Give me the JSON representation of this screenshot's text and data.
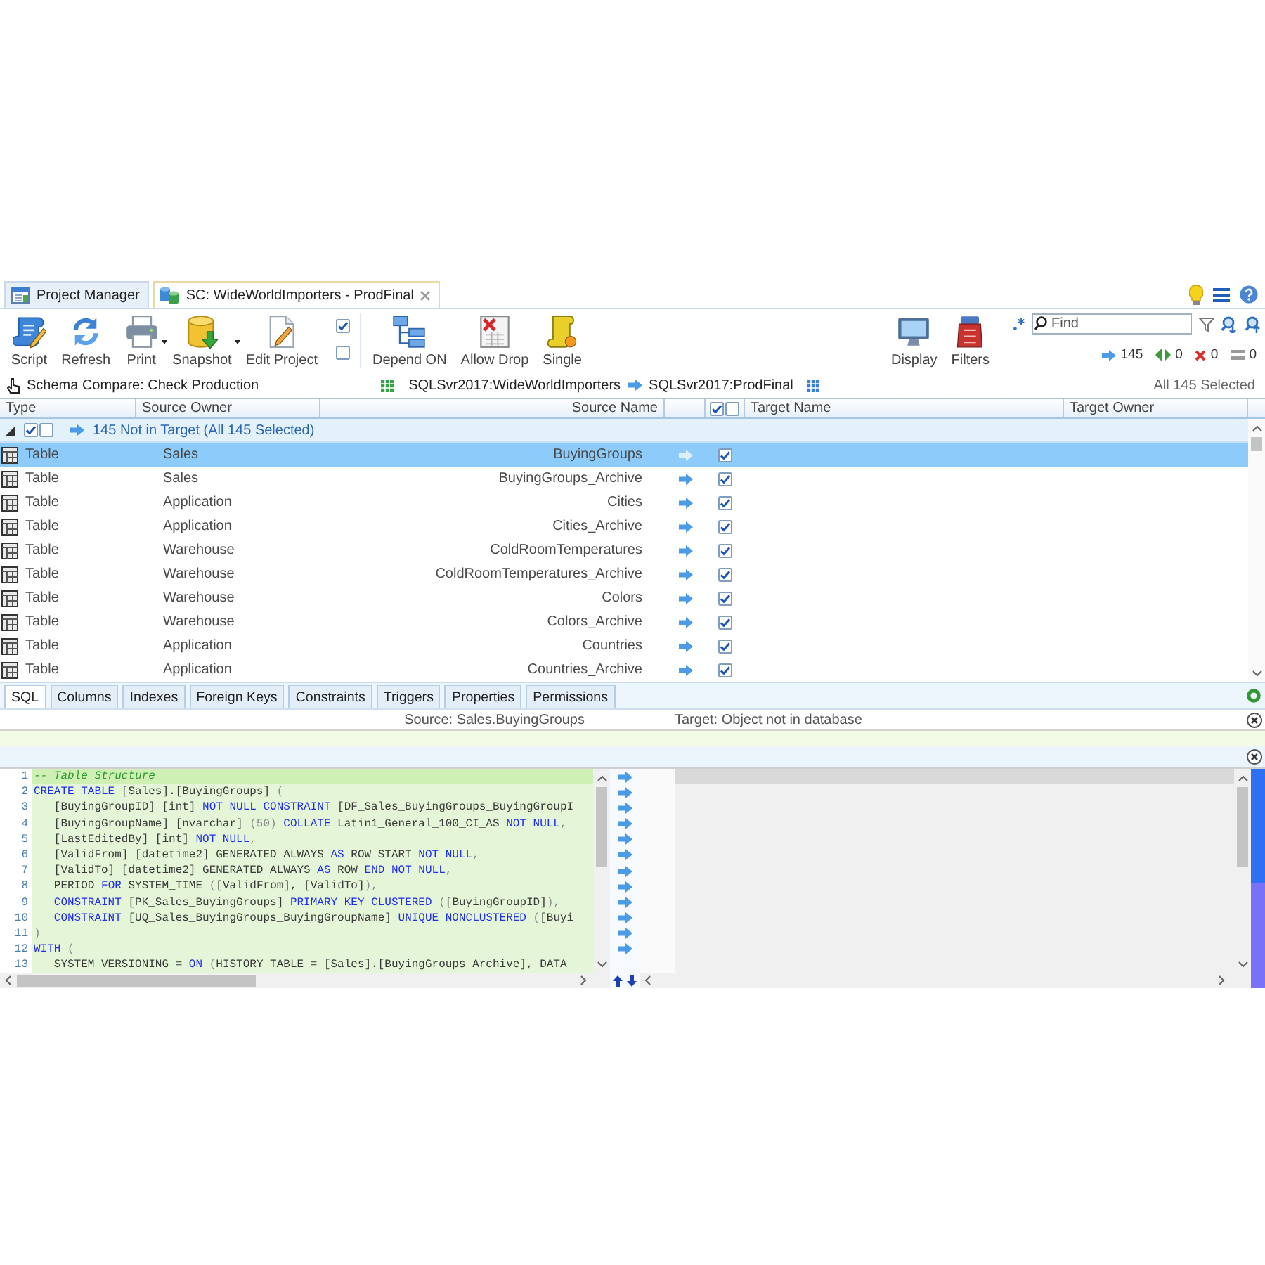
{
  "tabs": [
    {
      "label": "Project Manager",
      "kind": "project",
      "selected": false,
      "closable": false
    },
    {
      "label": "SC: WideWorldImporters - ProdFinal",
      "kind": "compare",
      "selected": true,
      "closable": true
    }
  ],
  "toolbar": {
    "left_buttons": [
      {
        "label": "Script",
        "kind": "script",
        "dropdown": false
      },
      {
        "label": "Refresh",
        "kind": "refresh",
        "dropdown": false
      },
      {
        "label": "Print",
        "kind": "print",
        "dropdown": true
      },
      {
        "label": "Snapshot",
        "kind": "snapshot",
        "dropdown": true
      },
      {
        "label": "Edit Project",
        "kind": "edit",
        "dropdown": false
      }
    ],
    "options": [
      {
        "checked": true
      },
      {
        "checked": false
      }
    ],
    "middle_buttons": [
      {
        "label": "Depend ON",
        "kind": "depend",
        "dropdown": false
      },
      {
        "label": "Allow Drop",
        "kind": "drop",
        "dropdown": false
      },
      {
        "label": "Single",
        "kind": "single",
        "dropdown": false
      }
    ],
    "right_buttons": [
      {
        "label": "Display",
        "kind": "display",
        "dropdown": false
      },
      {
        "label": "Filters",
        "kind": "filters",
        "dropdown": false
      }
    ],
    "search": {
      "placeholder": "Find"
    },
    "counts": [
      {
        "kind": "right",
        "value": "145"
      },
      {
        "kind": "both",
        "value": "0"
      },
      {
        "kind": "cross",
        "value": "0"
      },
      {
        "kind": "equal",
        "value": "0"
      }
    ]
  },
  "compare_bar": {
    "title": "Schema Compare: Check Production",
    "source": "SQLSvr2017:WideWorldImporters",
    "target": "SQLSvr2017:ProdFinal",
    "status": "All 145 Selected"
  },
  "grid": {
    "columns": [
      "Type",
      "Source Owner",
      "Source Name",
      "Target Name",
      "Target Owner"
    ],
    "header_checks": [
      {
        "checked": true
      },
      {
        "checked": false
      }
    ],
    "group": {
      "expanded": true,
      "checks": [
        {
          "checked": true
        },
        {
          "checked": false
        }
      ],
      "label": "145 Not in Target (All 145 Selected)"
    },
    "rows": [
      {
        "type": "Table",
        "source_owner": "Sales",
        "source_name": "BuyingGroups",
        "checked": true,
        "selected": true
      },
      {
        "type": "Table",
        "source_owner": "Sales",
        "source_name": "BuyingGroups_Archive",
        "checked": true,
        "selected": false
      },
      {
        "type": "Table",
        "source_owner": "Application",
        "source_name": "Cities",
        "checked": true,
        "selected": false
      },
      {
        "type": "Table",
        "source_owner": "Application",
        "source_name": "Cities_Archive",
        "checked": true,
        "selected": false
      },
      {
        "type": "Table",
        "source_owner": "Warehouse",
        "source_name": "ColdRoomTemperatures",
        "checked": true,
        "selected": false
      },
      {
        "type": "Table",
        "source_owner": "Warehouse",
        "source_name": "ColdRoomTemperatures_Archive",
        "checked": true,
        "selected": false
      },
      {
        "type": "Table",
        "source_owner": "Warehouse",
        "source_name": "Colors",
        "checked": true,
        "selected": false
      },
      {
        "type": "Table",
        "source_owner": "Warehouse",
        "source_name": "Colors_Archive",
        "checked": true,
        "selected": false
      },
      {
        "type": "Table",
        "source_owner": "Application",
        "source_name": "Countries",
        "checked": true,
        "selected": false
      },
      {
        "type": "Table",
        "source_owner": "Application",
        "source_name": "Countries_Archive",
        "checked": true,
        "selected": false
      }
    ]
  },
  "detail_tabs": [
    {
      "label": "SQL",
      "selected": true
    },
    {
      "label": "Columns",
      "selected": false
    },
    {
      "label": "Indexes",
      "selected": false
    },
    {
      "label": "Foreign Keys",
      "selected": false
    },
    {
      "label": "Constraints",
      "selected": false
    },
    {
      "label": "Triggers",
      "selected": false
    },
    {
      "label": "Properties",
      "selected": false
    },
    {
      "label": "Permissions",
      "selected": false
    }
  ],
  "detail": {
    "source": "Source: Sales.BuyingGroups",
    "target": "Target: Object not in database"
  },
  "sql": {
    "lines": [
      {
        "number": "1",
        "current": true,
        "arrow": true,
        "segments": [
          {
            "kind": "comment",
            "text": "-- Table Structure"
          }
        ]
      },
      {
        "number": "2",
        "current": false,
        "arrow": true,
        "segments": [
          {
            "kind": "keyword",
            "text": "CREATE TABLE"
          },
          {
            "kind": "plain",
            "text": " [Sales].[BuyingGroups] "
          },
          {
            "kind": "punct",
            "text": "("
          }
        ]
      },
      {
        "number": "3",
        "current": false,
        "arrow": true,
        "segments": [
          {
            "kind": "plain",
            "text": "   [BuyingGroupID] [int] "
          },
          {
            "kind": "keyword",
            "text": "NOT NULL CONSTRAINT"
          },
          {
            "kind": "plain",
            "text": " [DF_Sales_BuyingGroups_BuyingGroupI"
          }
        ]
      },
      {
        "number": "4",
        "current": false,
        "arrow": true,
        "segments": [
          {
            "kind": "plain",
            "text": "   [BuyingGroupName] [nvarchar] "
          },
          {
            "kind": "punct",
            "text": "(50) "
          },
          {
            "kind": "keyword",
            "text": "COLLATE"
          },
          {
            "kind": "plain",
            "text": " Latin1_General_100_CI_AS "
          },
          {
            "kind": "keyword",
            "text": "NOT NULL"
          },
          {
            "kind": "punct",
            "text": ","
          }
        ]
      },
      {
        "number": "5",
        "current": false,
        "arrow": true,
        "segments": [
          {
            "kind": "plain",
            "text": "   [LastEditedBy] [int] "
          },
          {
            "kind": "keyword",
            "text": "NOT NULL"
          },
          {
            "kind": "punct",
            "text": ","
          }
        ]
      },
      {
        "number": "6",
        "current": false,
        "arrow": true,
        "segments": [
          {
            "kind": "plain",
            "text": "   [ValidFrom] [datetime2] GENERATED ALWAYS "
          },
          {
            "kind": "keyword",
            "text": "AS"
          },
          {
            "kind": "plain",
            "text": " ROW START "
          },
          {
            "kind": "keyword",
            "text": "NOT NULL"
          },
          {
            "kind": "punct",
            "text": ","
          }
        ]
      },
      {
        "number": "7",
        "current": false,
        "arrow": true,
        "segments": [
          {
            "kind": "plain",
            "text": "   [ValidTo] [datetime2] GENERATED ALWAYS "
          },
          {
            "kind": "keyword",
            "text": "AS"
          },
          {
            "kind": "plain",
            "text": " ROW "
          },
          {
            "kind": "keyword",
            "text": "END NOT NULL"
          },
          {
            "kind": "punct",
            "text": ","
          }
        ]
      },
      {
        "number": "8",
        "current": false,
        "arrow": true,
        "segments": [
          {
            "kind": "plain",
            "text": "   PERIOD "
          },
          {
            "kind": "keyword",
            "text": "FOR"
          },
          {
            "kind": "plain",
            "text": " SYSTEM_TIME "
          },
          {
            "kind": "punct",
            "text": "("
          },
          {
            "kind": "plain",
            "text": "[ValidFrom], [ValidTo]"
          },
          {
            "kind": "punct",
            "text": "),"
          }
        ]
      },
      {
        "number": "9",
        "current": false,
        "arrow": true,
        "segments": [
          {
            "kind": "keyword",
            "text": "   CONSTRAINT"
          },
          {
            "kind": "plain",
            "text": " [PK_Sales_BuyingGroups] "
          },
          {
            "kind": "keyword",
            "text": "PRIMARY KEY CLUSTERED"
          },
          {
            "kind": "punct",
            "text": " ("
          },
          {
            "kind": "plain",
            "text": "[BuyingGroupID]"
          },
          {
            "kind": "punct",
            "text": "),"
          }
        ]
      },
      {
        "number": "10",
        "current": false,
        "arrow": true,
        "segments": [
          {
            "kind": "keyword",
            "text": "   CONSTRAINT"
          },
          {
            "kind": "plain",
            "text": " [UQ_Sales_BuyingGroups_BuyingGroupName] "
          },
          {
            "kind": "keyword",
            "text": "UNIQUE NONCLUSTERED"
          },
          {
            "kind": "punct",
            "text": " ("
          },
          {
            "kind": "plain",
            "text": "[Buyi"
          }
        ]
      },
      {
        "number": "11",
        "current": false,
        "arrow": true,
        "segments": [
          {
            "kind": "punct",
            "text": ")"
          }
        ]
      },
      {
        "number": "12",
        "current": false,
        "arrow": true,
        "segments": [
          {
            "kind": "keyword",
            "text": "WITH"
          },
          {
            "kind": "punct",
            "text": " ("
          }
        ]
      },
      {
        "number": "13",
        "current": false,
        "arrow": false,
        "segments": [
          {
            "kind": "plain",
            "text": "   SYSTEM_VERSIONING = "
          },
          {
            "kind": "keyword",
            "text": "ON"
          },
          {
            "kind": "punct",
            "text": " ("
          },
          {
            "kind": "plain",
            "text": "HISTORY_TABLE = [Sales].[BuyingGroups_Archive], DATA_"
          }
        ]
      }
    ]
  }
}
